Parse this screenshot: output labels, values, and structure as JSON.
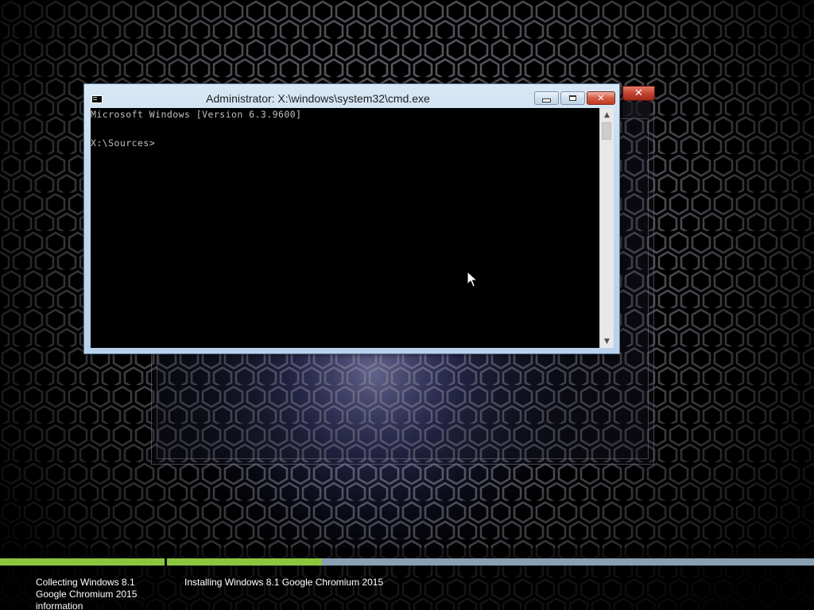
{
  "desktop": {
    "background": "dark-hexagon-mesh",
    "glow_color": "#9a9cff"
  },
  "setup_window": {
    "close_icon": "close-icon",
    "close_color": "#c1402e"
  },
  "cmd_window": {
    "title": "Administrator: X:\\windows\\system32\\cmd.exe",
    "icon": "cmd-icon",
    "buttons": {
      "minimize_icon": "minimize-icon",
      "maximize_icon": "maximize-icon",
      "close_icon": "close-icon",
      "close_glyph": "✕"
    },
    "console": {
      "background": "#000000",
      "text_color": "#c0c0c0",
      "lines": [
        "Microsoft Windows [Version 6.3.9600]",
        "X:\\Sources>"
      ]
    },
    "scrollbar": {
      "up_glyph": "▲",
      "down_glyph": "▼"
    }
  },
  "setup_progress": {
    "fill_color": "#8cc63f",
    "track_color": "#8aa0b2",
    "steps": [
      {
        "label": "Collecting Windows 8.1 Google Chromium 2015 information",
        "progress": 1.0
      },
      {
        "label": "Installing Windows 8.1 Google Chromium 2015",
        "progress": 0.24
      }
    ]
  }
}
